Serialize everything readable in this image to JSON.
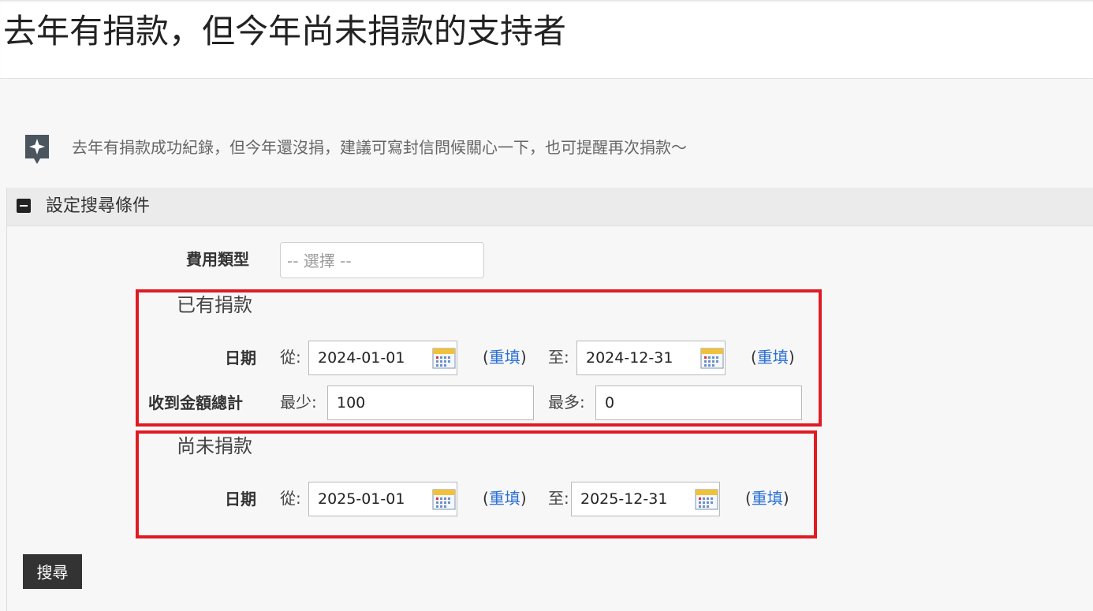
{
  "page": {
    "title": "去年有捐款，但今年尚未捐款的支持者"
  },
  "hint": {
    "icon": "sparkle-icon",
    "text": "去年有捐款成功紀錄，但今年還沒捐，建議可寫封信問候關心一下，也可提醒再次捐款～"
  },
  "filter_panel": {
    "title": "設定搜尋條件",
    "toggle_icon": "minus-square-icon",
    "fee_type": {
      "label": "費用類型",
      "placeholder": "-- 選擇 --"
    },
    "donated": {
      "title": "已有捐款",
      "date_label": "日期",
      "from_label": "從:",
      "from_value": "2024-01-01",
      "to_label": "至:",
      "to_value": "2024-12-31",
      "reset_open": "(",
      "reset_label": "重填",
      "reset_close": ")",
      "amount_label": "收到金額總計",
      "min_label": "最少:",
      "min_value": "100",
      "max_label": "最多:",
      "max_value": "0"
    },
    "not_donated": {
      "title": "尚未捐款",
      "date_label": "日期",
      "from_label": "從:",
      "from_value": "2025-01-01",
      "to_label": "至:",
      "to_value": "2025-12-31",
      "reset_open": "(",
      "reset_label": "重填",
      "reset_close": ")"
    },
    "search_button": "搜尋"
  },
  "colors": {
    "highlight_border": "#e01b24",
    "link": "#2a6fd6",
    "button_bg": "#333333"
  }
}
